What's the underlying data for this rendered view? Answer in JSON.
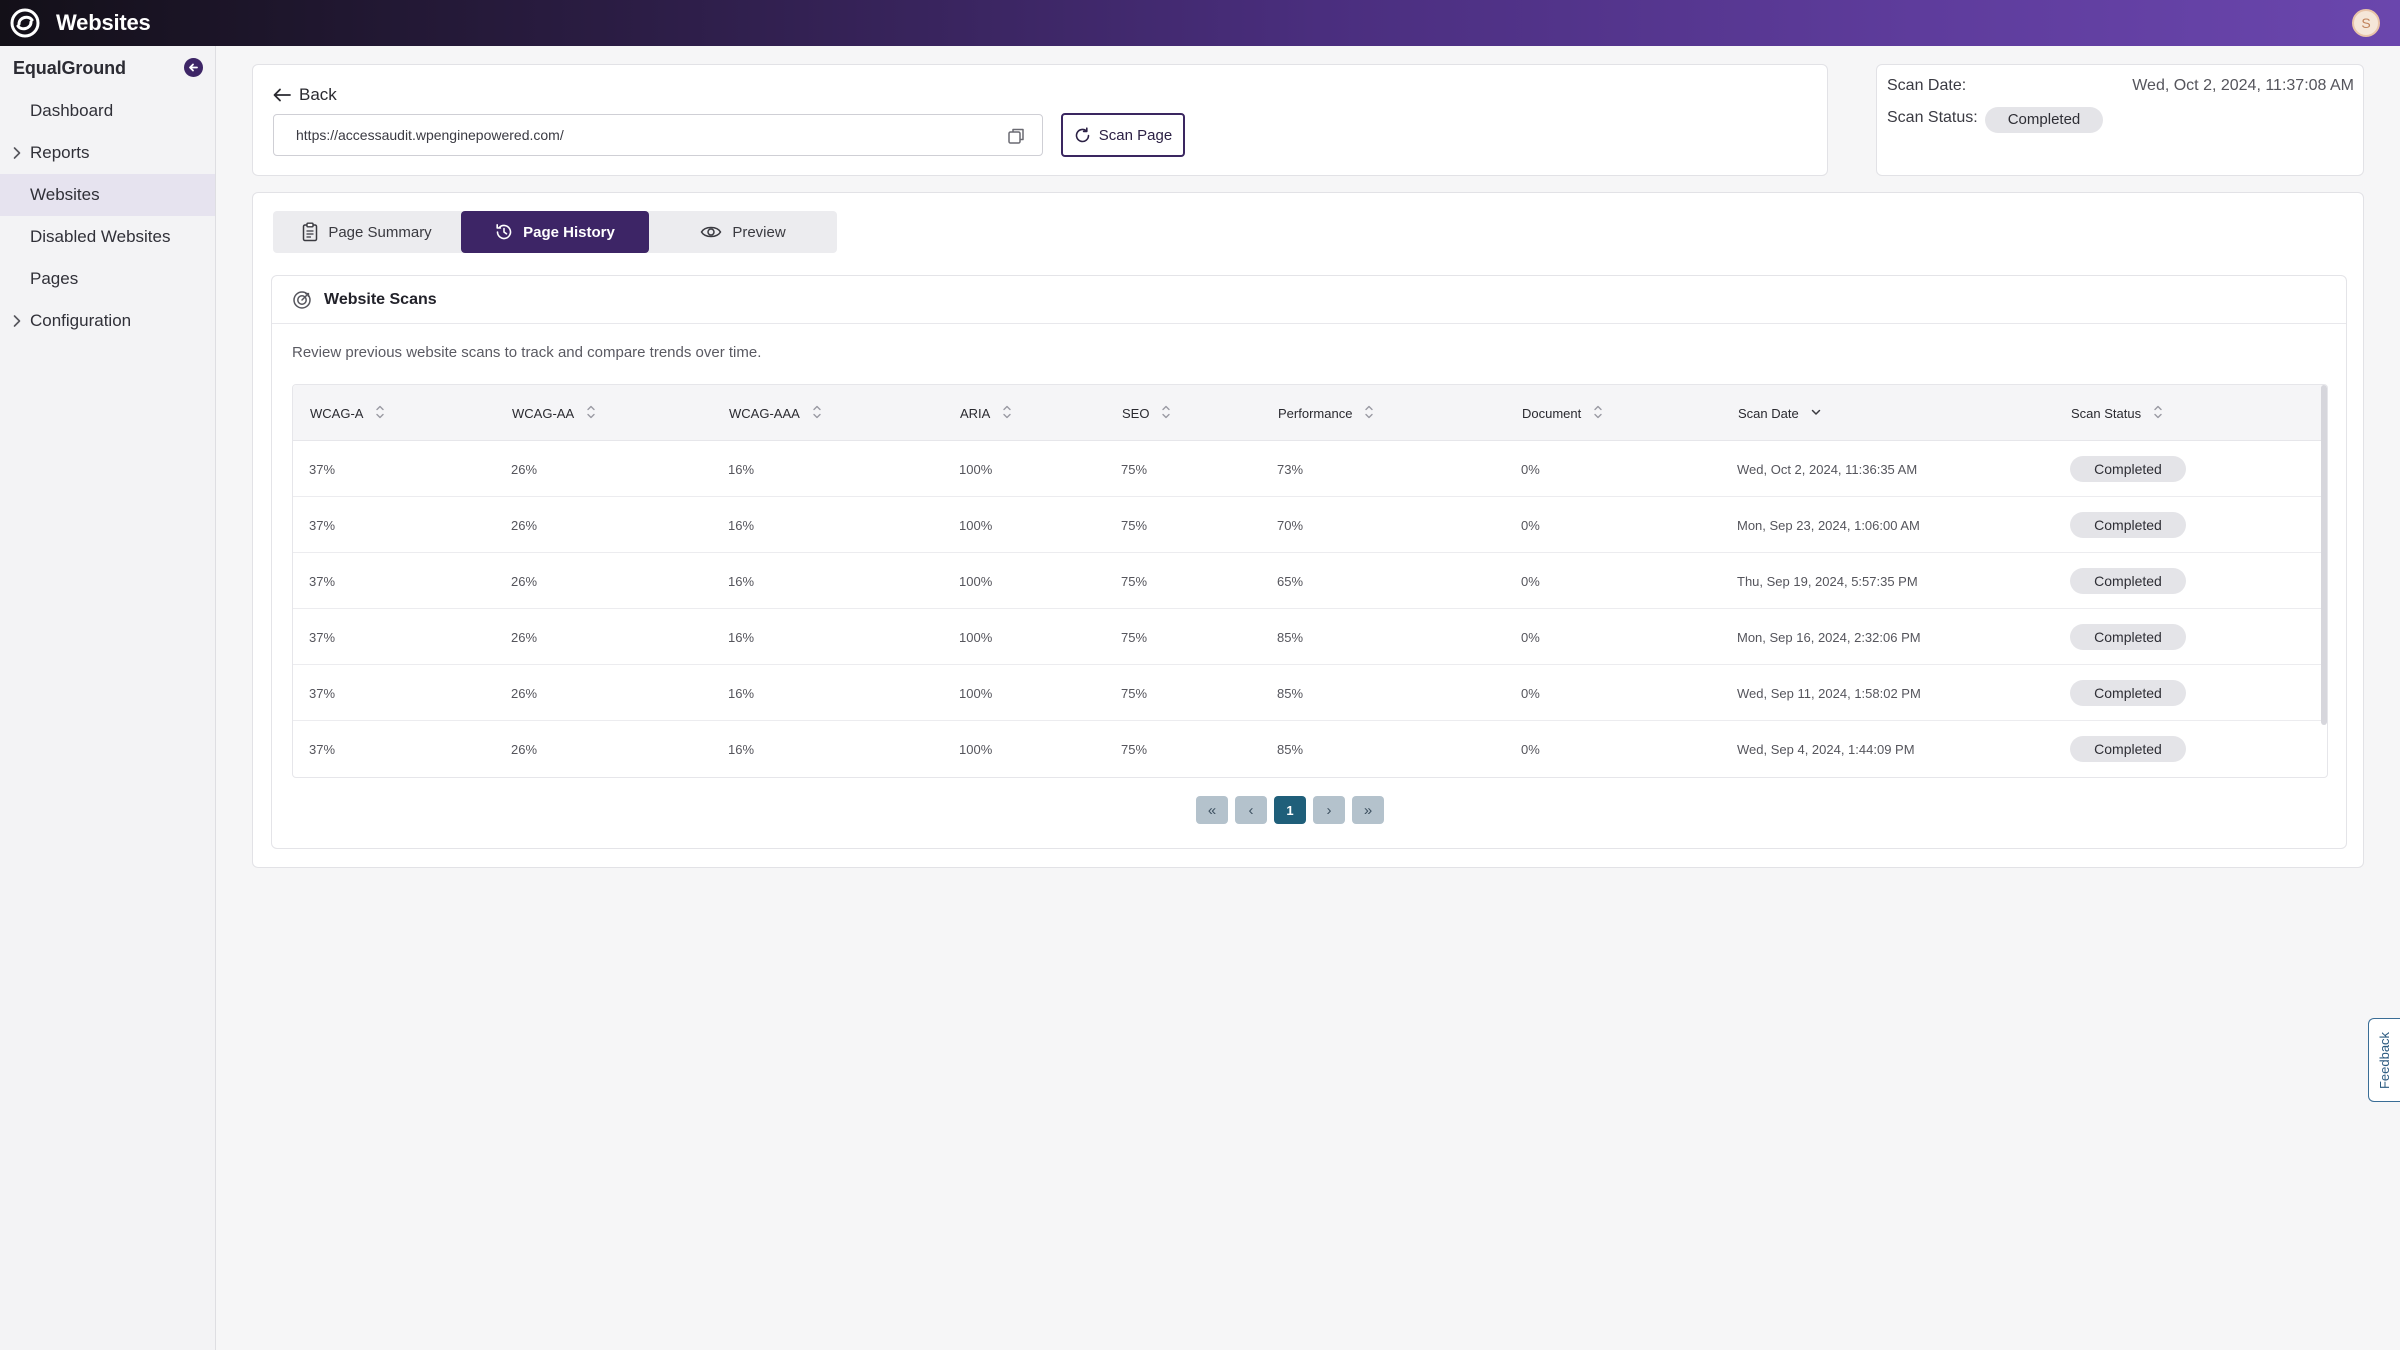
{
  "app": {
    "title": "Websites",
    "avatar_initial": "S"
  },
  "sidebar": {
    "org_name": "EqualGround",
    "items": [
      {
        "label": "Dashboard",
        "expandable": false,
        "active": false
      },
      {
        "label": "Reports",
        "expandable": true,
        "active": false
      },
      {
        "label": "Websites",
        "expandable": false,
        "active": true
      },
      {
        "label": "Disabled Websites",
        "expandable": false,
        "active": false
      },
      {
        "label": "Pages",
        "expandable": false,
        "active": false
      },
      {
        "label": "Configuration",
        "expandable": true,
        "active": false
      }
    ]
  },
  "page": {
    "back_label": "Back",
    "url": "https://accessaudit.wpenginepowered.com/",
    "scan_button_label": "Scan Page"
  },
  "scan_info": {
    "date_label": "Scan Date:",
    "date_value": "Wed, Oct 2, 2024, 11:37:08 AM",
    "status_label": "Scan Status:",
    "status_value": "Completed"
  },
  "tabs": [
    {
      "label": "Page Summary",
      "icon": "clipboard-icon",
      "active": false
    },
    {
      "label": "Page History",
      "icon": "history-icon",
      "active": true
    },
    {
      "label": "Preview",
      "icon": "eye-icon",
      "active": false
    }
  ],
  "scans": {
    "title": "Website Scans",
    "description": "Review previous website scans to track and compare trends over time.",
    "columns": [
      "WCAG-A",
      "WCAG-AA",
      "WCAG-AAA",
      "ARIA",
      "SEO",
      "Performance",
      "Document",
      "Scan Date",
      "Scan Status"
    ],
    "rows": [
      [
        "37%",
        "26%",
        "16%",
        "100%",
        "75%",
        "73%",
        "0%",
        "Wed, Oct 2, 2024, 11:36:35 AM",
        "Completed"
      ],
      [
        "37%",
        "26%",
        "16%",
        "100%",
        "75%",
        "70%",
        "0%",
        "Mon, Sep 23, 2024, 1:06:00 AM",
        "Completed"
      ],
      [
        "37%",
        "26%",
        "16%",
        "100%",
        "75%",
        "65%",
        "0%",
        "Thu, Sep 19, 2024, 5:57:35 PM",
        "Completed"
      ],
      [
        "37%",
        "26%",
        "16%",
        "100%",
        "75%",
        "85%",
        "0%",
        "Mon, Sep 16, 2024, 2:32:06 PM",
        "Completed"
      ],
      [
        "37%",
        "26%",
        "16%",
        "100%",
        "75%",
        "85%",
        "0%",
        "Wed, Sep 11, 2024, 1:58:02 PM",
        "Completed"
      ],
      [
        "37%",
        "26%",
        "16%",
        "100%",
        "75%",
        "85%",
        "0%",
        "Wed, Sep 4, 2024, 1:44:09 PM",
        "Completed"
      ]
    ]
  },
  "pagination": {
    "first": "«",
    "prev": "‹",
    "current": "1",
    "next": "›",
    "last": "»"
  },
  "feedback_label": "Feedback",
  "colors": {
    "brand": "#3d2566",
    "pager_active": "#1f5f7a"
  }
}
